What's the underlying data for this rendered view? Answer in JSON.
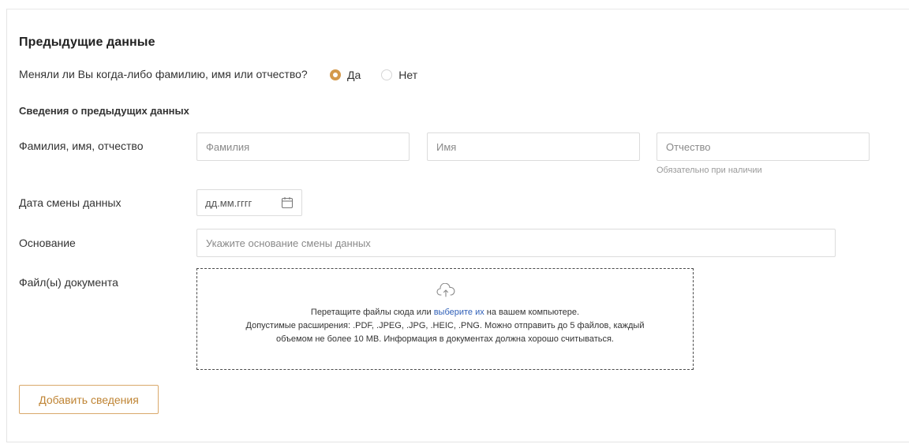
{
  "section": {
    "title": "Предыдущие данные",
    "question": "Меняли ли Вы когда-либо фамилию, имя или отчество?",
    "options": [
      {
        "label": "Да",
        "selected": true
      },
      {
        "label": "Нет",
        "selected": false
      }
    ],
    "subheading": "Сведения о предыдущих данных"
  },
  "fio": {
    "label": "Фамилия, имя, отчество",
    "surname_placeholder": "Фамилия",
    "name_placeholder": "Имя",
    "patronymic_placeholder": "Отчество",
    "patronymic_hint": "Обязательно при наличии"
  },
  "date": {
    "label": "Дата смены данных",
    "placeholder": "дд.мм.гггг",
    "icon": "calendar-icon"
  },
  "reason": {
    "label": "Основание",
    "placeholder": "Укажите основание смены данных"
  },
  "files": {
    "label": "Файл(ы) документа",
    "icon": "cloud-upload-icon",
    "drop_text_before": "Перетащите файлы сюда или ",
    "drop_link": "выберите их",
    "drop_text_after": " на вашем компьютере.",
    "line2": "Допустимые расширения: .PDF, .JPEG, .JPG, .HEIC, .PNG. Можно отправить до 5 файлов, каждый",
    "line3": "объемом не более 10 MB. Информация в документах должна хорошо считываться."
  },
  "add_button": "Добавить сведения",
  "colors": {
    "accent": "#d4994b",
    "button_text": "#bf8434",
    "link": "#2f5fb8"
  }
}
